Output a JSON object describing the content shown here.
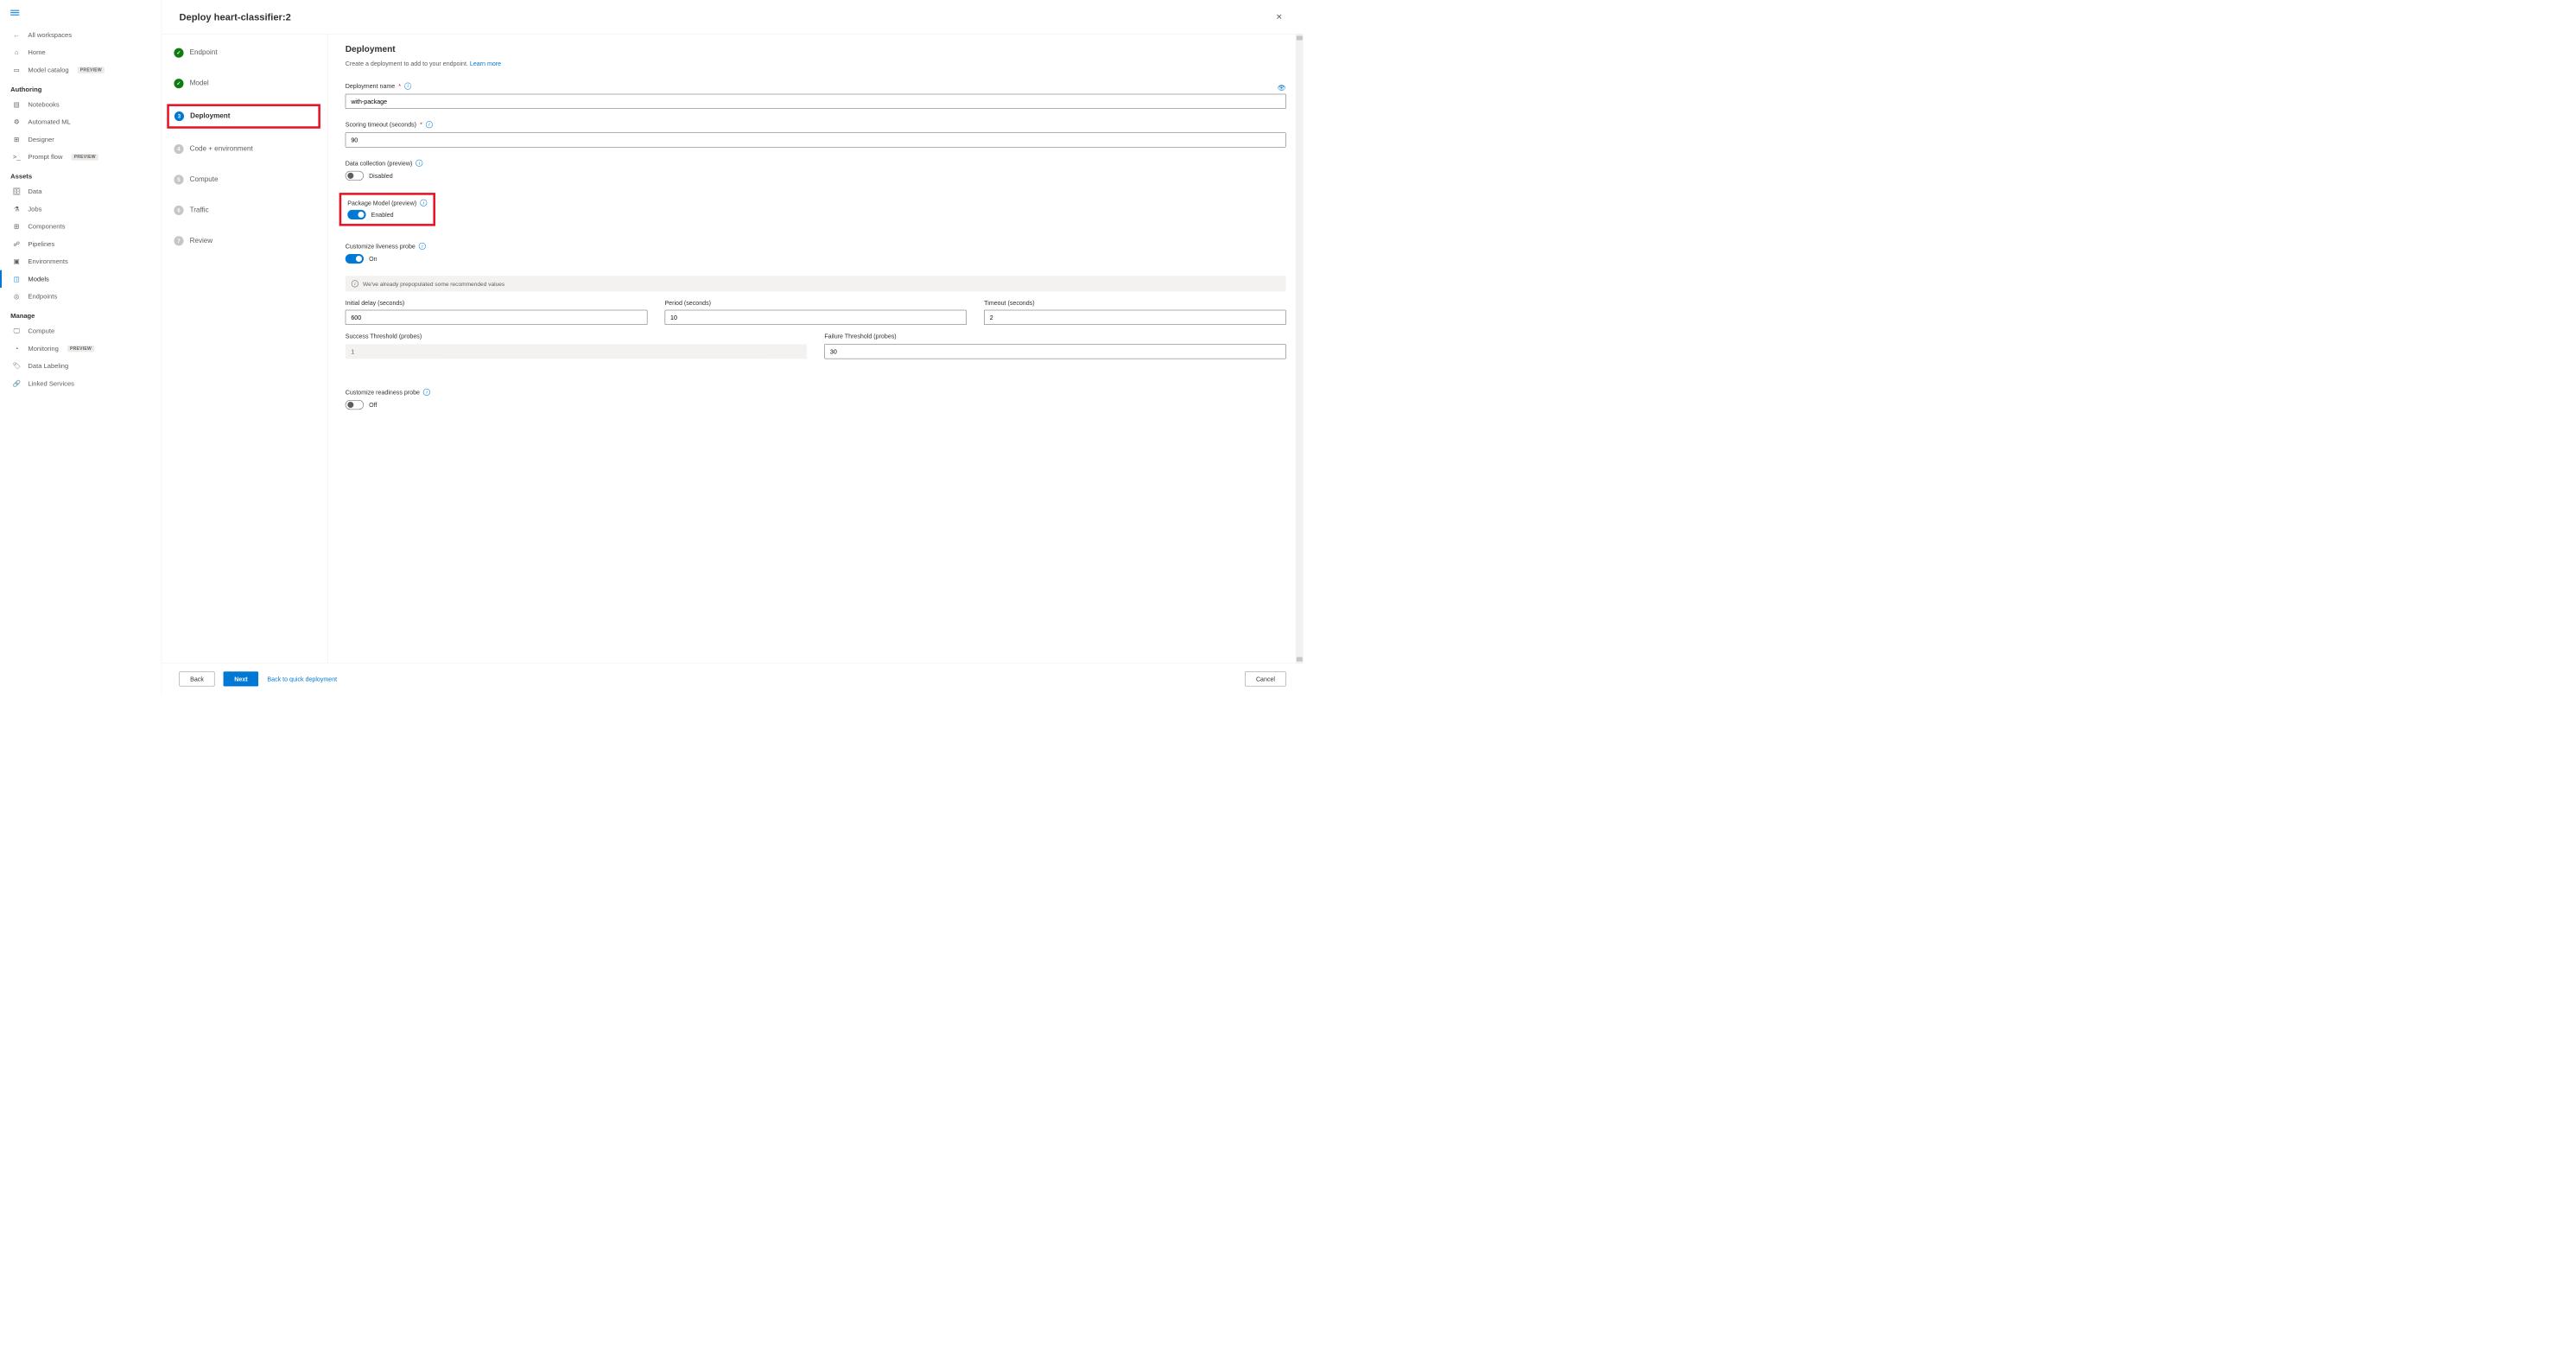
{
  "sidebar": {
    "all_workspaces": "All workspaces",
    "home": "Home",
    "model_catalog": "Model catalog",
    "preview_badge": "PREVIEW",
    "sections": {
      "authoring": "Authoring",
      "assets": "Assets",
      "manage": "Manage"
    },
    "authoring_items": {
      "notebooks": "Notebooks",
      "automated_ml": "Automated ML",
      "designer": "Designer",
      "prompt_flow": "Prompt flow"
    },
    "assets_items": {
      "data": "Data",
      "jobs": "Jobs",
      "components": "Components",
      "pipelines": "Pipelines",
      "environments": "Environments",
      "models": "Models",
      "endpoints": "Endpoints"
    },
    "manage_items": {
      "compute": "Compute",
      "monitoring": "Monitoring",
      "data_labeling": "Data Labeling",
      "linked_services": "Linked Services"
    }
  },
  "dialog": {
    "title": "Deploy heart-classifier:2"
  },
  "stepper": {
    "steps": [
      {
        "label": "Endpoint"
      },
      {
        "label": "Model"
      },
      {
        "label": "Deployment"
      },
      {
        "label": "Code + environment"
      },
      {
        "label": "Compute"
      },
      {
        "label": "Traffic"
      },
      {
        "label": "Review"
      }
    ]
  },
  "form": {
    "title": "Deployment",
    "description": "Create a deployment to add to your endpoint. ",
    "learn_more": "Learn more",
    "labels": {
      "deployment_name": "Deployment name",
      "scoring_timeout": "Scoring timeout (seconds)",
      "data_collection": "Data collection (preview)",
      "package_model": "Package Model (preview)",
      "customize_liveness": "Customize liveness probe",
      "initial_delay": "Initial delay (seconds)",
      "period": "Period (seconds)",
      "timeout": "Timeout (seconds)",
      "success_threshold": "Success Threshold (probes)",
      "failure_threshold": "Failure Threshold (probes)",
      "customize_readiness": "Customize readiness probe"
    },
    "values": {
      "deployment_name": "with-package",
      "scoring_timeout": "90",
      "initial_delay": "600",
      "period": "10",
      "timeout": "2",
      "success_threshold": "1",
      "failure_threshold": "30"
    },
    "toggle_states": {
      "disabled": "Disabled",
      "enabled": "Enabled",
      "on": "On",
      "off": "Off"
    },
    "notice": "We've already prepopulated some recommended values"
  },
  "footer": {
    "back": "Back",
    "next": "Next",
    "quick": "Back to quick deployment",
    "cancel": "Cancel"
  }
}
